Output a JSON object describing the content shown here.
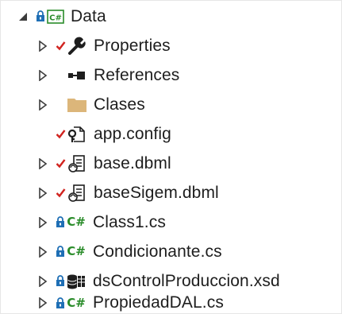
{
  "tree": {
    "root": {
      "label": "Data",
      "expanded": true,
      "badge": "C#"
    },
    "items": [
      {
        "label": "Properties",
        "icon": "wrench-icon",
        "pending_change": true
      },
      {
        "label": "References",
        "icon": "references-icon",
        "pending_change": false
      },
      {
        "label": "Clases",
        "icon": "folder-icon",
        "pending_change": false
      },
      {
        "label": "app.config",
        "icon": "config-file-icon",
        "pending_change": true
      },
      {
        "label": "base.dbml",
        "icon": "dbml-file-icon",
        "pending_change": true
      },
      {
        "label": "baseSigem.dbml",
        "icon": "dbml-file-icon",
        "pending_change": true
      },
      {
        "label": "Class1.cs",
        "icon": "csharp-file-icon",
        "locked": true,
        "badge": "C#"
      },
      {
        "label": "Condicionante.cs",
        "icon": "csharp-file-icon",
        "locked": true,
        "badge": "C#"
      },
      {
        "label": "dsControlProduccion.xsd",
        "icon": "dataset-icon",
        "locked": true
      },
      {
        "label": "PropiedadDAL.cs",
        "icon": "csharp-file-icon",
        "locked": true,
        "badge": "C#"
      }
    ]
  },
  "colors": {
    "text": "#1e1e1e",
    "check_red": "#d1231f",
    "lock_blue": "#1f6fb5",
    "csharp_green": "#2a8c2a",
    "folder_tan": "#dcb67a",
    "arrow_gray": "#3c3c3c"
  }
}
